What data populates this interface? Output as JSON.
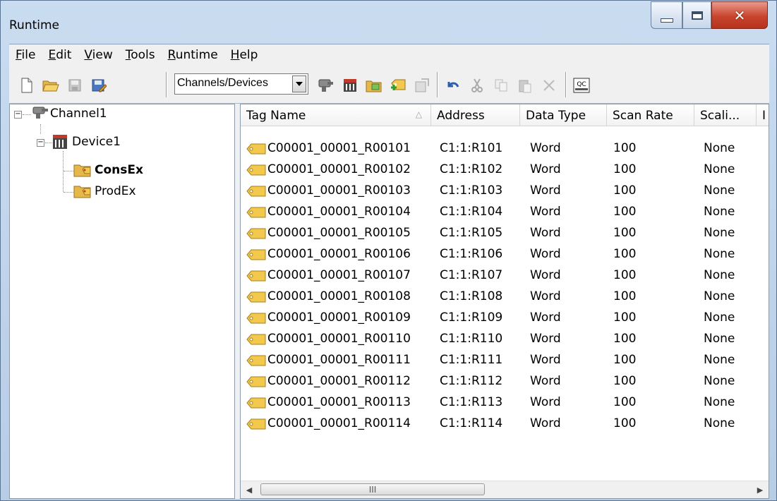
{
  "window": {
    "title": "Runtime"
  },
  "menu": {
    "items": [
      {
        "label": "File",
        "accel": "F",
        "rest": "ile"
      },
      {
        "label": "Edit",
        "accel": "E",
        "rest": "dit"
      },
      {
        "label": "View",
        "accel": "V",
        "rest": "iew"
      },
      {
        "label": "Tools",
        "accel": "T",
        "rest": "ools"
      },
      {
        "label": "Runtime",
        "accel": "R",
        "rest": "untime"
      },
      {
        "label": "Help",
        "accel": "H",
        "rest": "elp"
      }
    ]
  },
  "toolbar": {
    "view_selector_value": "Channels/Devices",
    "quick_client_label": "QC"
  },
  "tree": {
    "channel": "Channel1",
    "device": "Device1",
    "groups": [
      "ConsEx",
      "ProdEx"
    ],
    "selected_group": "ConsEx"
  },
  "table": {
    "columns": [
      "Tag Name",
      "Address",
      "Data Type",
      "Scan Rate",
      "Scali...",
      "I"
    ],
    "sort_column": "Tag Name",
    "rows": [
      {
        "name": "C00001_00001_R00101",
        "address": "C1:1:R101",
        "type": "Word",
        "rate": "100",
        "scaling": "None"
      },
      {
        "name": "C00001_00001_R00102",
        "address": "C1:1:R102",
        "type": "Word",
        "rate": "100",
        "scaling": "None"
      },
      {
        "name": "C00001_00001_R00103",
        "address": "C1:1:R103",
        "type": "Word",
        "rate": "100",
        "scaling": "None"
      },
      {
        "name": "C00001_00001_R00104",
        "address": "C1:1:R104",
        "type": "Word",
        "rate": "100",
        "scaling": "None"
      },
      {
        "name": "C00001_00001_R00105",
        "address": "C1:1:R105",
        "type": "Word",
        "rate": "100",
        "scaling": "None"
      },
      {
        "name": "C00001_00001_R00106",
        "address": "C1:1:R106",
        "type": "Word",
        "rate": "100",
        "scaling": "None"
      },
      {
        "name": "C00001_00001_R00107",
        "address": "C1:1:R107",
        "type": "Word",
        "rate": "100",
        "scaling": "None"
      },
      {
        "name": "C00001_00001_R00108",
        "address": "C1:1:R108",
        "type": "Word",
        "rate": "100",
        "scaling": "None"
      },
      {
        "name": "C00001_00001_R00109",
        "address": "C1:1:R109",
        "type": "Word",
        "rate": "100",
        "scaling": "None"
      },
      {
        "name": "C00001_00001_R00110",
        "address": "C1:1:R110",
        "type": "Word",
        "rate": "100",
        "scaling": "None"
      },
      {
        "name": "C00001_00001_R00111",
        "address": "C1:1:R111",
        "type": "Word",
        "rate": "100",
        "scaling": "None"
      },
      {
        "name": "C00001_00001_R00112",
        "address": "C1:1:R112",
        "type": "Word",
        "rate": "100",
        "scaling": "None"
      },
      {
        "name": "C00001_00001_R00113",
        "address": "C1:1:R113",
        "type": "Word",
        "rate": "100",
        "scaling": "None"
      },
      {
        "name": "C00001_00001_R00114",
        "address": "C1:1:R114",
        "type": "Word",
        "rate": "100",
        "scaling": "None"
      }
    ]
  },
  "scrollbar": {
    "thumb_grip": "III"
  },
  "colors": {
    "tag_icon": "#f2c94c",
    "close_button": "#c9442d",
    "frame": "#b7cde6"
  }
}
